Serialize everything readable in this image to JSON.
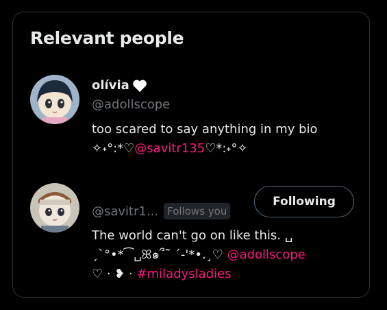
{
  "section": {
    "title": "Relevant people"
  },
  "people": [
    {
      "name": "olívia",
      "name_emoji": "white-heart-icon",
      "handle": "@adollscope",
      "bio_line1": "too scared to say anything in my bio",
      "bio_line2_pre": "✧˖°:*♡",
      "bio_line2_mention": "@savitr135",
      "bio_line2_post": "♡*:˖°✧"
    },
    {
      "handle": "@savitr1...",
      "follows_you": "Follows you",
      "follow_button": "Following",
      "bio_line1": "The world can't go on like this. ␣",
      "bio_line2_pre": "ˏˋ°•*⁀␣ꕤ๑՞˜ ˊ-'*•.¸♡ ",
      "bio_line2_mention": "@adollscope",
      "bio_line3_pre": "♡ · ❥ ·  ",
      "bio_line3_hashtag": "#miladysladies"
    }
  ],
  "colors": {
    "accent": "#f91880",
    "muted": "#71767b",
    "text": "#e7e9ea",
    "border": "#2f3336"
  }
}
